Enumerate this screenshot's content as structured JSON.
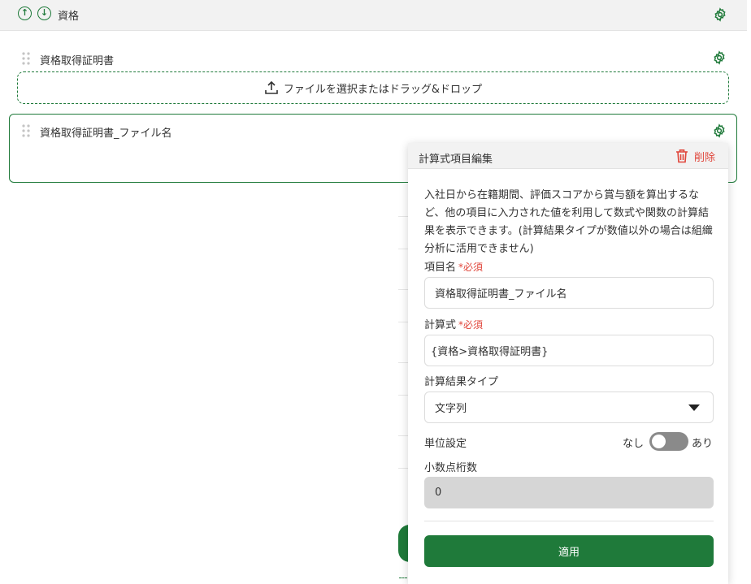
{
  "section": {
    "title": "資格"
  },
  "fields": [
    {
      "label": "資格取得証明書",
      "upload_text": "ファイルを選択またはドラッグ&ドロップ"
    },
    {
      "label": "資格取得証明書_ファイル名"
    }
  ],
  "popup": {
    "title": "計算式項目編集",
    "delete_label": "削除",
    "description": "入社日から在籍期間、評価スコアから賞与額を算出するなど、他の項目に入力された値を利用して数式や関数の計算結果を表示できます。(計算結果タイプが数値以外の場合は組織分析に活用できません)",
    "item_name": {
      "label": "項目名",
      "required": "*必須",
      "value": "資格取得証明書_ファイル名"
    },
    "formula": {
      "label": "計算式",
      "required": "*必須",
      "value": "{資格>資格取得証明書}"
    },
    "result_type": {
      "label": "計算結果タイプ",
      "value": "文字列"
    },
    "unit": {
      "label": "単位設定",
      "off_label": "なし",
      "on_label": "あり",
      "enabled": false
    },
    "decimals": {
      "label": "小数点桁数",
      "value": "0"
    },
    "apply_label": "適用"
  },
  "colors": {
    "accent": "#1f7a3a",
    "danger": "#e0453a"
  }
}
